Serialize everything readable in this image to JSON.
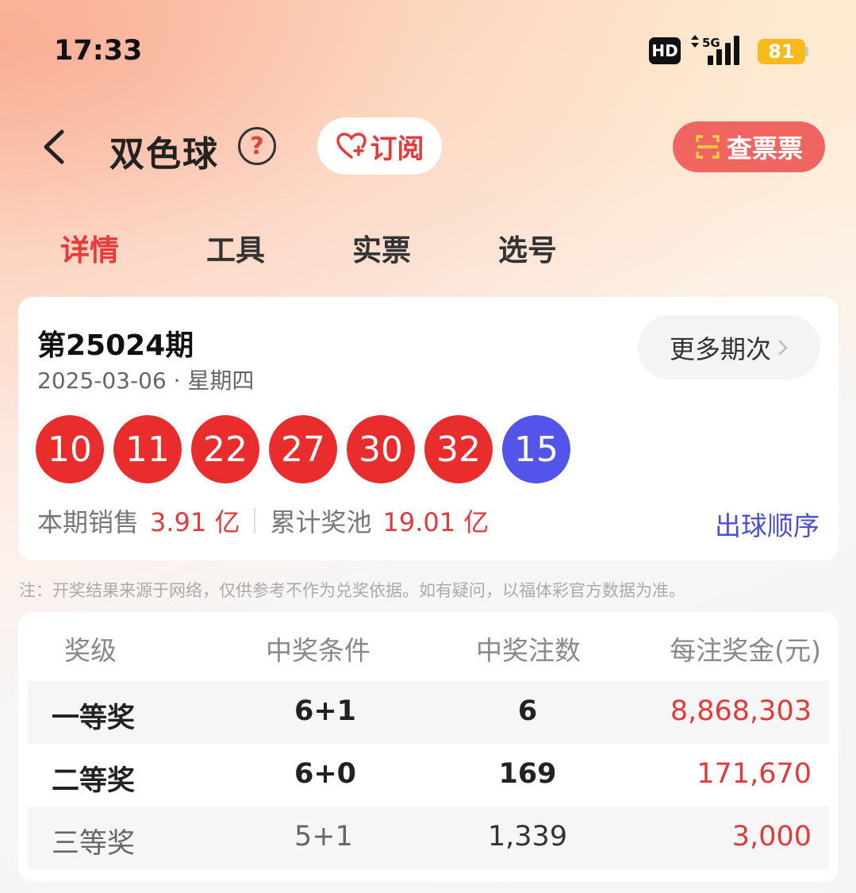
{
  "status": {
    "time": "17:33",
    "hd": "HD",
    "network": "5G",
    "battery": "81"
  },
  "header": {
    "title": "双色球",
    "help": "?",
    "subscribe_label": "订阅",
    "check_ticket_label": "查票票"
  },
  "tabs": [
    {
      "label": "详情",
      "active": true
    },
    {
      "label": "工具",
      "active": false
    },
    {
      "label": "实票",
      "active": false
    },
    {
      "label": "选号",
      "active": false
    }
  ],
  "draw": {
    "issue": "第25024期",
    "date": "2025-03-06 · 星期四",
    "more_label": "更多期次",
    "red_balls": [
      "10",
      "11",
      "22",
      "27",
      "30",
      "32"
    ],
    "blue_ball": "15",
    "sales_label": "本期销售",
    "sales_value": "3.91 亿",
    "pool_label": "累计奖池",
    "pool_value": "19.01 亿",
    "order_link": "出球顺序"
  },
  "note": "注：开奖结果来源于网络，仅供参考不作为兑奖依据。如有疑问，以福体彩官方数据为准。",
  "prizes": {
    "headers": [
      "奖级",
      "中奖条件",
      "中奖注数",
      "每注奖金(元)"
    ],
    "rows": [
      {
        "level": "一等奖",
        "condition": "6+1",
        "count": "6",
        "amount": "8,868,303"
      },
      {
        "level": "二等奖",
        "condition": "6+0",
        "count": "169",
        "amount": "171,670"
      },
      {
        "level": "三等奖",
        "condition": "5+1",
        "count": "1,339",
        "amount": "3,000"
      }
    ]
  },
  "colors": {
    "accent_red": "#e83a3a",
    "ball_red": "#e92d2d",
    "ball_blue": "#5254ea",
    "link_blue": "#4a50d0",
    "battery": "#f8b91a"
  }
}
